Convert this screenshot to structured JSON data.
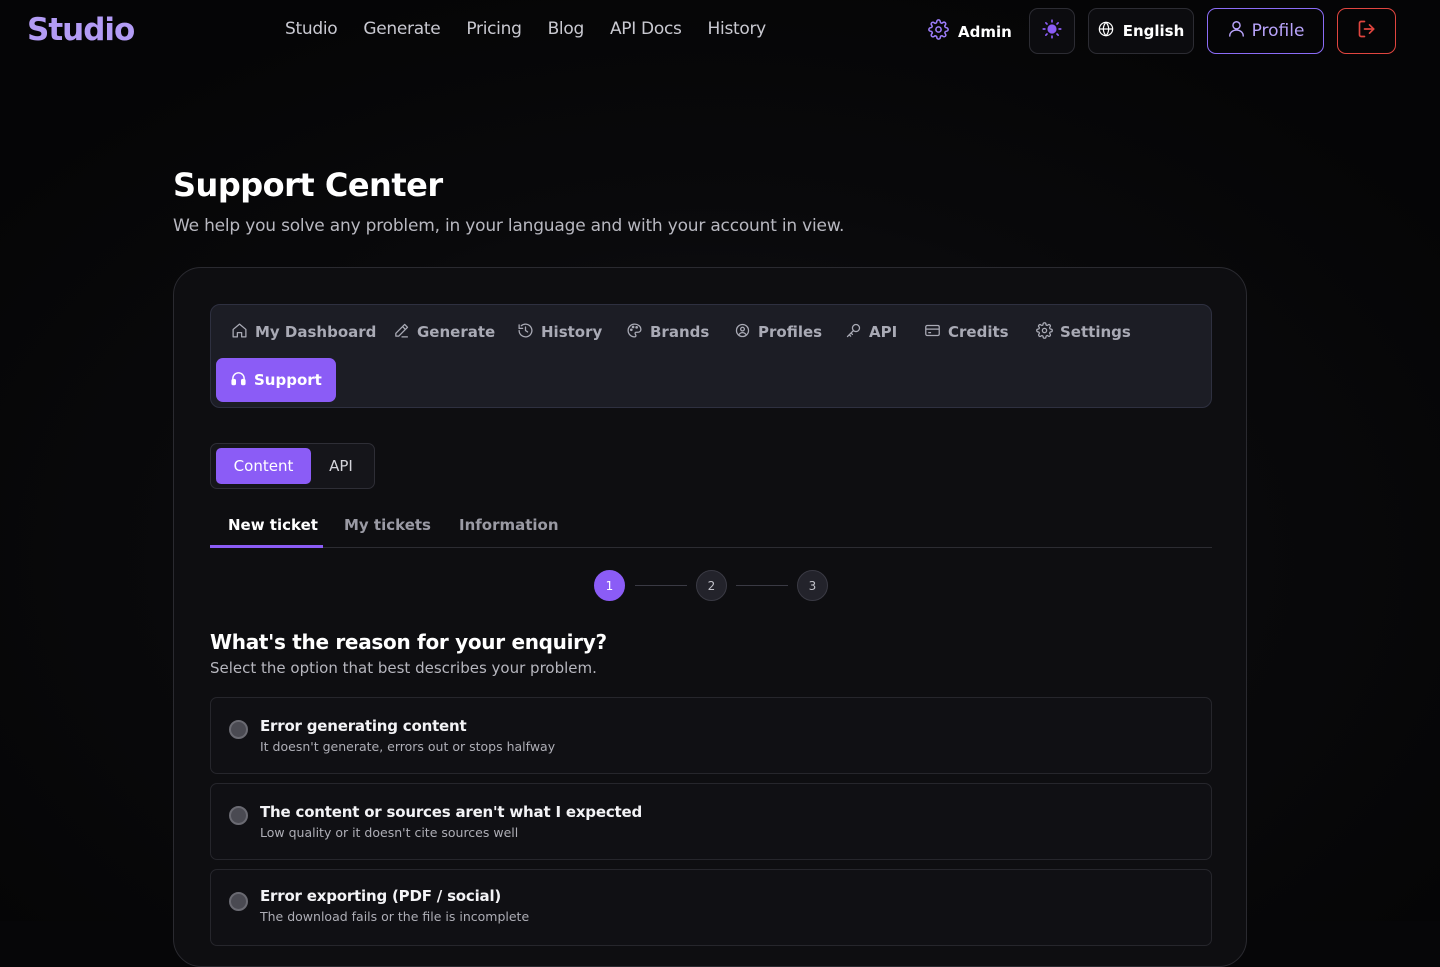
{
  "app": {
    "logo": "Studio"
  },
  "nav": {
    "items": [
      "Studio",
      "Generate",
      "Pricing",
      "Blog",
      "API Docs",
      "History"
    ]
  },
  "header": {
    "admin_label": "Admin",
    "language_label": "English",
    "profile_label": "Profile"
  },
  "page": {
    "title": "Support Center",
    "subtitle": "We help you solve any problem, in your language and with your account in view."
  },
  "subnav": {
    "items": [
      {
        "label": "My Dashboard",
        "icon": "home-icon"
      },
      {
        "label": "Generate",
        "icon": "pen-icon"
      },
      {
        "label": "History",
        "icon": "history-icon"
      },
      {
        "label": "Brands",
        "icon": "palette-icon"
      },
      {
        "label": "Profiles",
        "icon": "profile-gear-icon"
      },
      {
        "label": "API",
        "icon": "key-icon"
      },
      {
        "label": "Credits",
        "icon": "card-icon"
      },
      {
        "label": "Settings",
        "icon": "gear-icon"
      },
      {
        "label": "Support",
        "icon": "headset-icon",
        "active": true
      }
    ]
  },
  "segment": {
    "options": [
      "Content",
      "API"
    ],
    "selected": "Content"
  },
  "tabs": {
    "items": [
      "New ticket",
      "My tickets",
      "Information"
    ],
    "active": "New ticket"
  },
  "stepper": {
    "steps": [
      "1",
      "2",
      "3"
    ],
    "current": 1
  },
  "question": {
    "title": "What's the reason for your enquiry?",
    "subtitle": "Select the option that best describes your problem."
  },
  "options": [
    {
      "title": "Error generating content",
      "desc": "It doesn't generate, errors out or stops halfway"
    },
    {
      "title": "The content or sources aren't what I expected",
      "desc": "Low quality or it doesn't cite sources well"
    },
    {
      "title": "Error exporting (PDF / social)",
      "desc": "The download fails or the file is incomplete"
    }
  ],
  "colors": {
    "accent": "#8b5cf6",
    "logout": "#e0453f",
    "background": "#09090b"
  }
}
